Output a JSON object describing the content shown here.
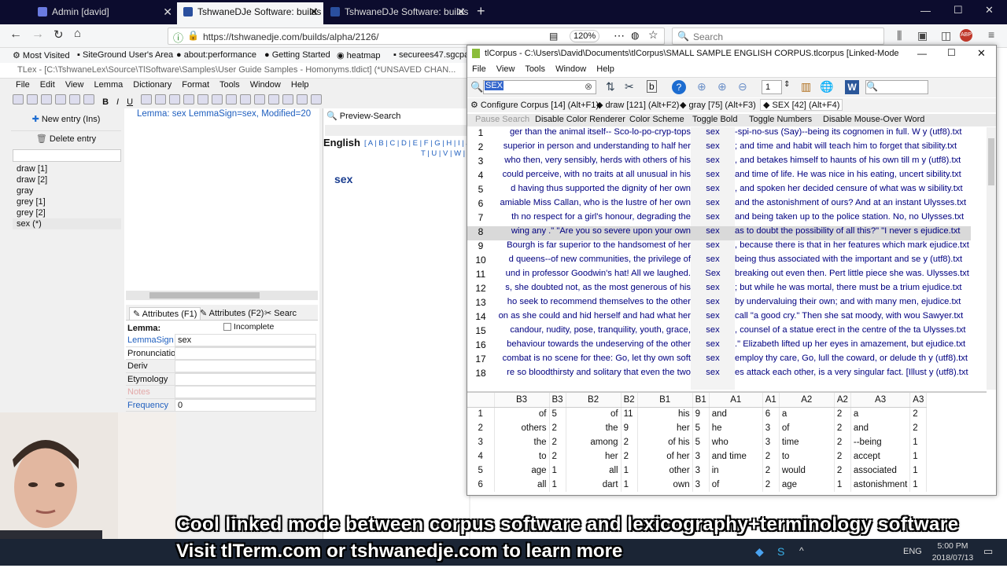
{
  "browser": {
    "tabs": [
      {
        "label": "Admin [david]"
      },
      {
        "label": "TshwaneDJe Software: builds /"
      },
      {
        "label": "TshwaneDJe Software: builds /"
      }
    ],
    "new_tab": "+",
    "url": "https://tshwanedje.com/builds/alpha/2126/",
    "zoom": "120%",
    "search_placeholder": "Search",
    "bookmarks": [
      "Most Visited",
      "SiteGround User's Area",
      "about:performance",
      "Getting Started",
      "heatmap",
      "securees47.sgcpa"
    ]
  },
  "tlex": {
    "title": "TLex - [C:\\TshwaneLex\\Source\\TlSoftware\\Samples\\User Guide Samples - Homonyms.tldict] (*UNSAVED CHAN...",
    "menu": [
      "File",
      "Edit",
      "View",
      "Lemma",
      "Dictionary",
      "Format",
      "Tools",
      "Window",
      "Help"
    ],
    "new_entry": "New entry (Ins)",
    "delete_entry": "Delete entry",
    "lemmas": [
      "draw [1]",
      "draw [2]",
      "gray",
      "grey [1]",
      "grey [2]",
      "sex (*)"
    ],
    "entry_header": "Lemma: sex  LemmaSign=sex, Modified=20",
    "preview_search": "Preview-Search",
    "language": "English",
    "alphabet1": "[ A | B | C | D | E | F | G | H | I | J | K | L",
    "alphabet2": "T | U | V | W | X",
    "preview_word": "sex",
    "attr_tabs": [
      "Attributes (F1)",
      "Attributes (F2)",
      "Searc"
    ],
    "lemma_label": "Lemma:",
    "incomplete": "Incomplete",
    "fields": [
      {
        "label": "LemmaSign",
        "value": "sex"
      },
      {
        "label": "Pronunciation",
        "value": ""
      },
      {
        "label": "Deriv",
        "value": ""
      },
      {
        "label": "Etymology",
        "value": ""
      },
      {
        "label": "Notes",
        "value": ""
      },
      {
        "label": "Frequency",
        "value": "0"
      }
    ]
  },
  "tlcorpus": {
    "title": "tlCorpus - C:\\Users\\David\\Documents\\tlCorpus\\SMALL SAMPLE ENGLISH CORPUS.tlcorpus [Linked-Mode Enabled]",
    "menu": [
      "File",
      "View",
      "Tools",
      "Window",
      "Help"
    ],
    "search_value": "SEX",
    "page_number": "1",
    "tabs": [
      "Configure Corpus [14] (Alt+F1)",
      "draw [121] (Alt+F2)",
      "gray [75] (Alt+F3)",
      "SEX [42] (Alt+F4)"
    ],
    "buttons": [
      "Pause Search",
      "Disable Color Renderer",
      "Color Scheme",
      "Toggle Bold",
      "Toggle Numbers",
      "Disable Mouse-Over Word"
    ],
    "concordance": [
      {
        "n": "1",
        "left": "ger than the animal itself-- Sco-lo-po-cryp-tops",
        "kw": "sex",
        "right": "-spi-no-sus  (Say)--being its cognomen in full. W",
        "file": "y (utf8).txt"
      },
      {
        "n": "2",
        "left": "superior in person and understanding to half her",
        "kw": "sex",
        "right": "; and time and habit will teach him to forget that",
        "file": "sibility.txt"
      },
      {
        "n": "3",
        "left": "who then, very sensibly, herds with others of his",
        "kw": "sex",
        "right": ", and betakes himself to haunts of his own till m",
        "file": "y (utf8).txt"
      },
      {
        "n": "4",
        "left": "could perceive, with no traits at all unusual in his",
        "kw": "sex",
        "right": "and time of life. He was nice in his eating, uncert",
        "file": "sibility.txt"
      },
      {
        "n": "5",
        "left": "d having thus supported the dignity of her own",
        "kw": "sex",
        "right": ", and spoken her decided censure of what was w",
        "file": "sibility.txt"
      },
      {
        "n": "6",
        "left": "amiable Miss Callan, who is the lustre of her own",
        "kw": "sex",
        "right": "and the astonishment of ours? And at an instant",
        "file": "Ulysses.txt"
      },
      {
        "n": "7",
        "left": "th no respect for a girl's honour, degrading the",
        "kw": "sex",
        "right": "and being taken up to the police station. No, no",
        "file": "Ulysses.txt"
      },
      {
        "n": "8",
        "left": "wing  any  .\" \"Are you so severe upon your own",
        "kw": "sex",
        "right": "as to doubt the possibility of all this?\" \"I never s",
        "file": "ejudice.txt"
      },
      {
        "n": "9",
        "left": "Bourgh is far superior to the handsomest of her",
        "kw": "sex",
        "right": ", because there is that in her features which mark",
        "file": "ejudice.txt"
      },
      {
        "n": "10",
        "left": "d queens--of new communities, the privilege of",
        "kw": "sex",
        "right": "being thus associated with the important and se",
        "file": "y (utf8).txt"
      },
      {
        "n": "11",
        "left": "und in professor Goodwin's hat! All we laughed.",
        "kw": "Sex",
        "right": "breaking out even then. Pert little piece she was.",
        "file": "Ulysses.txt"
      },
      {
        "n": "12",
        "left": "s, she doubted not, as the most generous of his",
        "kw": "sex",
        "right": "; but while he was mortal, there must be a trium",
        "file": "ejudice.txt"
      },
      {
        "n": "13",
        "left": "ho seek to recommend themselves to the other",
        "kw": "sex",
        "right": "by undervaluing their own; and with many men, ",
        "file": "ejudice.txt"
      },
      {
        "n": "14",
        "left": "on as she could and hid herself and had what her",
        "kw": "sex",
        "right": "call \"a good cry.\" Then she sat moody, with wou",
        "file": "Sawyer.txt"
      },
      {
        "n": "15",
        "left": "candour, nudity, pose, tranquility, youth, grace,",
        "kw": "sex",
        "right": ", counsel of a statue erect in the centre of the ta",
        "file": "Ulysses.txt"
      },
      {
        "n": "16",
        "left": "behaviour towards the undeserving of the other",
        "kw": "sex",
        "right": ".\" Elizabeth lifted up her eyes in amazement, but",
        "file": "ejudice.txt"
      },
      {
        "n": "17",
        "left": "combat is no scene for thee: Go, let thy own soft",
        "kw": "sex",
        "right": "employ thy care, Go, lull the coward, or delude th",
        "file": "y (utf8).txt"
      },
      {
        "n": "18",
        "left": "re so bloodthirsty and solitary that even the two",
        "kw": "sex",
        "right": "es attack each other, is a very singular fact. [Illust",
        "file": "y (utf8).txt"
      }
    ],
    "collocation_headers": [
      "B3",
      "B3",
      "B2",
      "B2",
      "B1",
      "B1",
      "A1",
      "A1",
      "A2",
      "A2",
      "A3",
      "A3"
    ],
    "collocations": [
      {
        "n": "1",
        "cells": [
          "of",
          "5",
          "of",
          "11",
          "his",
          "9",
          "and",
          "6",
          "a",
          "2",
          "a",
          "2"
        ]
      },
      {
        "n": "2",
        "cells": [
          "others",
          "2",
          "the",
          "9",
          "her",
          "5",
          "he",
          "3",
          "of",
          "2",
          "and",
          "2"
        ]
      },
      {
        "n": "3",
        "cells": [
          "the",
          "2",
          "among",
          "2",
          "of his",
          "5",
          "who",
          "3",
          "time",
          "2",
          "--being",
          "1"
        ]
      },
      {
        "n": "4",
        "cells": [
          "to",
          "2",
          "her",
          "2",
          "of her",
          "3",
          "and time",
          "2",
          "to",
          "2",
          "accept",
          "1"
        ]
      },
      {
        "n": "5",
        "cells": [
          "age",
          "1",
          "all",
          "1",
          "other",
          "3",
          "in",
          "2",
          "would",
          "2",
          "associated",
          "1"
        ]
      },
      {
        "n": "6",
        "cells": [
          "all",
          "1",
          "dart",
          "1",
          "own",
          "3",
          "of",
          "2",
          "age",
          "1",
          "astonishment",
          "1"
        ]
      }
    ]
  },
  "overlay": {
    "line1": "Cool linked mode between corpus software and lexicography+terminology software",
    "line2": "Visit tlTerm.com or tshwanedje.com to learn more"
  },
  "taskbar": {
    "lang": "ENG",
    "time": "5:00 PM",
    "date": "2018/07/13"
  },
  "colors": {
    "tab_bar": "#0c0c2e",
    "keyword": "#000080",
    "link_blue": "#1f5fbf"
  }
}
